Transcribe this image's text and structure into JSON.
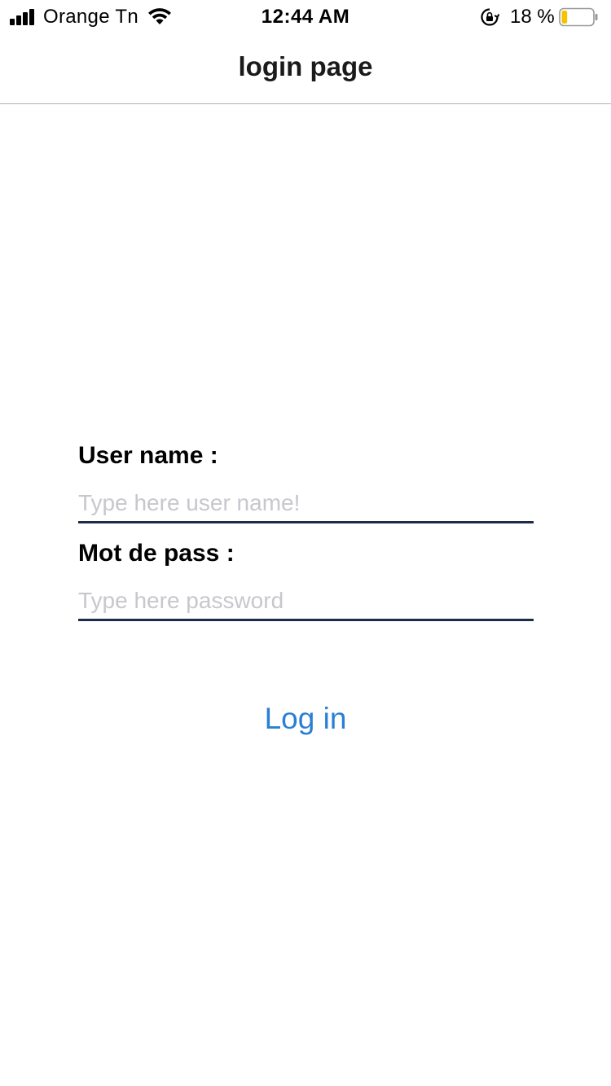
{
  "status_bar": {
    "carrier": "Orange Tn",
    "time": "12:44 AM",
    "battery_percent_label": "18 %",
    "battery_level": 0.18,
    "battery_fill_color": "#f5c400",
    "icons": [
      "signal-icon",
      "wifi-icon",
      "rotation-lock-icon",
      "battery-icon"
    ]
  },
  "nav": {
    "title": "login page"
  },
  "form": {
    "username": {
      "label": "User name :",
      "placeholder": "Type here user name!",
      "value": ""
    },
    "password": {
      "label": "Mot de pass :",
      "placeholder": "Type here password",
      "value": ""
    },
    "login_label": "Log in"
  },
  "colors": {
    "accent": "#2a7fd4",
    "input_underline": "#1e2a4a",
    "placeholder": "#c7c7cd"
  }
}
